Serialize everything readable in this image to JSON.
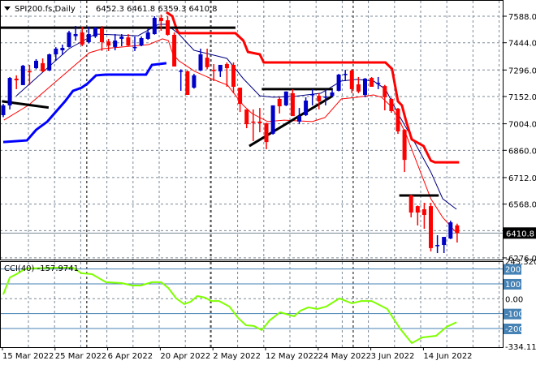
{
  "header": {
    "menu_icon": "triangle-down-icon",
    "symbol_timeframe": "SPI200.fs,Daily",
    "ohlc": "6452.3 6461.8 6359.3 6410.8"
  },
  "cci_panel": {
    "label": "CCI(40) -157.9741",
    "axis_labels": [
      {
        "text": "243.3203",
        "value": 252,
        "boxed": false
      },
      {
        "text": "200",
        "value": 200,
        "boxed": true
      },
      {
        "text": "100",
        "value": 100,
        "boxed": true
      },
      {
        "text": "0.00",
        "value": 0,
        "boxed": false
      },
      {
        "text": "-100",
        "value": -100,
        "boxed": true
      },
      {
        "text": "-200",
        "value": -200,
        "boxed": true
      },
      {
        "text": "-334.110",
        "value": -320,
        "boxed": false
      }
    ],
    "levels": [
      200,
      100,
      -100,
      -200
    ]
  },
  "colors": {
    "bull": "#0000c8",
    "bear": "#ff0000",
    "ma_upper": "#000080",
    "ma_lower": "#ff0000",
    "stop_lower": "#0000ff",
    "stop_upper": "#ff0000",
    "cci": "#7fff00",
    "level": "#4682b4",
    "grid": "#7a8896",
    "trendline": "#000000"
  },
  "chart_data": {
    "type": "candlestick",
    "title": "SPI200.fs,Daily",
    "ylim": [
      6276,
      7650
    ],
    "price_ticks": [
      "7588.0",
      "7444.0",
      "7296.0",
      "7152.0",
      "7004.0",
      "6860.0",
      "6712.0",
      "6568.0",
      "6276.0"
    ],
    "current_price": "6410.8",
    "x_labels": [
      {
        "text": "15 Mar 2022",
        "index": 0
      },
      {
        "text": "25 Mar 2022",
        "index": 8
      },
      {
        "text": "6 Apr 2022",
        "index": 16
      },
      {
        "text": "20 Apr 2022",
        "index": 24
      },
      {
        "text": "2 May 2022",
        "index": 32
      },
      {
        "text": "12 May 2022",
        "index": 40
      },
      {
        "text": "24 May 2022",
        "index": 48
      },
      {
        "text": "3 Jun 2022",
        "index": 56
      },
      {
        "text": "14 Jun 2022",
        "index": 64
      }
    ],
    "period_separators": [
      12.7,
      31.5,
      53.2
    ],
    "candles_ohlc": [
      [
        7051,
        7112,
        7040,
        7104
      ],
      [
        7104,
        7258,
        7082,
        7253
      ],
      [
        7249,
        7267,
        7192,
        7240
      ],
      [
        7214,
        7324,
        7214,
        7319
      ],
      [
        7290,
        7324,
        7214,
        7289
      ],
      [
        7306,
        7355,
        7300,
        7346
      ],
      [
        7333,
        7359,
        7285,
        7289
      ],
      [
        7293,
        7385,
        7290,
        7381
      ],
      [
        7381,
        7420,
        7346,
        7412
      ],
      [
        7403,
        7434,
        7377,
        7416
      ],
      [
        7421,
        7509,
        7418,
        7500
      ],
      [
        7480,
        7535,
        7456,
        7491
      ],
      [
        7500,
        7531,
        7425,
        7434
      ],
      [
        7447,
        7531,
        7440,
        7491
      ],
      [
        7478,
        7531,
        7470,
        7526
      ],
      [
        7522,
        7535,
        7400,
        7447
      ],
      [
        7451,
        7465,
        7399,
        7429
      ],
      [
        7421,
        7491,
        7403,
        7456
      ],
      [
        7465,
        7491,
        7425,
        7478
      ],
      [
        7473,
        7491,
        7425,
        7429
      ],
      [
        7418,
        7478,
        7399,
        7421
      ],
      [
        7429,
        7478,
        7425,
        7469
      ],
      [
        7465,
        7522,
        7460,
        7500
      ],
      [
        7491,
        7588,
        7488,
        7579
      ],
      [
        7579,
        7597,
        7509,
        7562
      ],
      [
        7566,
        7588,
        7482,
        7487
      ],
      [
        7487,
        7500,
        7315,
        7315
      ],
      [
        7289,
        7300,
        7183,
        7293
      ],
      [
        7289,
        7293,
        7161,
        7161
      ],
      [
        7200,
        7275,
        7195,
        7267
      ],
      [
        7293,
        7412,
        7290,
        7381
      ],
      [
        7363,
        7412,
        7300,
        7311
      ],
      [
        7297,
        7328,
        7236,
        7293
      ],
      [
        7289,
        7310,
        7258,
        7324
      ],
      [
        7328,
        7337,
        7205,
        7306
      ],
      [
        7324,
        7337,
        7170,
        7205
      ],
      [
        7200,
        7200,
        7068,
        7112
      ],
      [
        7082,
        7082,
        6980,
        7002
      ],
      [
        7016,
        7082,
        6910,
        7012
      ],
      [
        7016,
        7090,
        6958,
        7007
      ],
      [
        7007,
        7010,
        6866,
        6905
      ],
      [
        6950,
        7104,
        6945,
        7104
      ],
      [
        7139,
        7152,
        7060,
        7099
      ],
      [
        7104,
        7180,
        7100,
        7179
      ],
      [
        7170,
        7192,
        7046,
        7046
      ],
      [
        7016,
        7090,
        7002,
        7046
      ],
      [
        7051,
        7148,
        7046,
        7130
      ],
      [
        7161,
        7192,
        7104,
        7165
      ],
      [
        7156,
        7170,
        7082,
        7126
      ],
      [
        7148,
        7192,
        7104,
        7152
      ],
      [
        7156,
        7187,
        7150,
        7174
      ],
      [
        7183,
        7275,
        7180,
        7271
      ],
      [
        7271,
        7297,
        7236,
        7275
      ],
      [
        7293,
        7300,
        7170,
        7192
      ],
      [
        7218,
        7258,
        7170,
        7179
      ],
      [
        7161,
        7253,
        7148,
        7249
      ],
      [
        7253,
        7258,
        7205,
        7205
      ],
      [
        7225,
        7258,
        7192,
        7227
      ],
      [
        7209,
        7215,
        7077,
        7148
      ],
      [
        7139,
        7145,
        7064,
        7073
      ],
      [
        7086,
        7090,
        6949,
        6963
      ],
      [
        6971,
        6975,
        6742,
        6808
      ],
      [
        6615,
        6619,
        6496,
        6522
      ],
      [
        6557,
        6560,
        6452,
        6522
      ],
      [
        6540,
        6575,
        6434,
        6509
      ],
      [
        6557,
        6575,
        6311,
        6329
      ],
      [
        6342,
        6399,
        6302,
        6346
      ],
      [
        6346,
        6380,
        6302,
        6390
      ],
      [
        6381,
        6478,
        6378,
        6469
      ],
      [
        6452.3,
        6461.8,
        6359.3,
        6410.8
      ]
    ],
    "series": [
      {
        "name": "ma-upper",
        "width": 1,
        "color_key": "ma_upper",
        "points": [
          [
            2,
            7156
          ],
          [
            10,
            7412
          ],
          [
            14,
            7491
          ],
          [
            20.5,
            7482
          ],
          [
            23.6,
            7544
          ],
          [
            24.8,
            7544
          ],
          [
            26.7,
            7491
          ],
          [
            29,
            7403
          ],
          [
            34,
            7359
          ],
          [
            36.5,
            7249
          ],
          [
            39,
            7156
          ],
          [
            41,
            7148
          ],
          [
            44,
            7152
          ],
          [
            48.3,
            7170
          ],
          [
            51.4,
            7236
          ],
          [
            53.8,
            7245
          ],
          [
            56.3,
            7236
          ],
          [
            58.1,
            7192
          ],
          [
            60,
            7060
          ],
          [
            62.5,
            6905
          ],
          [
            65,
            6742
          ],
          [
            66.8,
            6597
          ],
          [
            68.9,
            6540
          ]
        ]
      },
      {
        "name": "ma-lower",
        "width": 1,
        "color_key": "ma_lower",
        "points": [
          [
            0.1,
            7024
          ],
          [
            3.8,
            7104
          ],
          [
            8.1,
            7236
          ],
          [
            13.1,
            7390
          ],
          [
            15.2,
            7412
          ],
          [
            22.1,
            7434
          ],
          [
            24.2,
            7465
          ],
          [
            25.1,
            7456
          ],
          [
            25.8,
            7381
          ],
          [
            26.7,
            7346
          ],
          [
            29.1,
            7289
          ],
          [
            31.6,
            7249
          ],
          [
            34.1,
            7214
          ],
          [
            36.5,
            7104
          ],
          [
            37.8,
            7060
          ],
          [
            40.2,
            7016
          ],
          [
            42.7,
            7024
          ],
          [
            47,
            7016
          ],
          [
            48.9,
            7038
          ],
          [
            51.4,
            7139
          ],
          [
            53.8,
            7148
          ],
          [
            56.3,
            7161
          ],
          [
            57.5,
            7148
          ],
          [
            58.8,
            7104
          ],
          [
            60,
            7038
          ],
          [
            61.2,
            6949
          ],
          [
            63.1,
            6773
          ],
          [
            65,
            6597
          ],
          [
            66.8,
            6496
          ],
          [
            68.9,
            6412
          ]
        ]
      },
      {
        "name": "stop-lower",
        "width": 3,
        "color_key": "stop_lower",
        "points": [
          [
            0,
            6905
          ],
          [
            3.6,
            6914
          ],
          [
            5,
            6971
          ],
          [
            6.7,
            7016
          ],
          [
            8.1,
            7073
          ],
          [
            9.4,
            7126
          ],
          [
            10.6,
            7183
          ],
          [
            11.9,
            7200
          ],
          [
            12.8,
            7222
          ],
          [
            14.1,
            7267
          ],
          [
            15.6,
            7271
          ],
          [
            21.7,
            7271
          ],
          [
            22.6,
            7324
          ],
          [
            24.8,
            7333
          ]
        ]
      },
      {
        "name": "stop-upper",
        "width": 3,
        "color_key": "stop_upper",
        "points": [
          [
            24.8,
            7610
          ],
          [
            25.7,
            7588
          ],
          [
            26.4,
            7513
          ],
          [
            26.7,
            7496
          ],
          [
            35.3,
            7496
          ],
          [
            36.5,
            7456
          ],
          [
            37.2,
            7394
          ],
          [
            39,
            7381
          ],
          [
            39.6,
            7337
          ],
          [
            58.1,
            7337
          ],
          [
            59.1,
            7302
          ],
          [
            60,
            7126
          ],
          [
            60.6,
            7104
          ],
          [
            61.2,
            7024
          ],
          [
            62.1,
            6919
          ],
          [
            63.9,
            6883
          ],
          [
            65,
            6804
          ],
          [
            65.6,
            6795
          ],
          [
            69.3,
            6795
          ]
        ]
      }
    ],
    "trendlines": [
      [
        [
          -0.5,
          7526
        ],
        [
          35.3,
          7526
        ]
      ],
      [
        [
          -0.2,
          7126
        ],
        [
          6.9,
          7092
        ]
      ],
      [
        [
          39.3,
          7192
        ],
        [
          50.1,
          7192
        ]
      ],
      [
        [
          37.4,
          6883
        ],
        [
          50.1,
          7156
        ]
      ],
      [
        [
          60.2,
          6615
        ],
        [
          66.2,
          6615
        ]
      ]
    ],
    "cci": {
      "name": "CCI(40)",
      "period": 40,
      "last": -157.9741,
      "ylim": [
        -334.11,
        243.3203
      ],
      "points": [
        [
          0,
          29
        ],
        [
          1,
          143
        ],
        [
          2,
          165
        ],
        [
          3,
          192
        ],
        [
          3.6,
          203
        ],
        [
          7.8,
          209
        ],
        [
          10.6,
          209
        ],
        [
          11.9,
          171
        ],
        [
          13.5,
          165
        ],
        [
          15.6,
          111
        ],
        [
          18,
          105
        ],
        [
          19.6,
          89
        ],
        [
          20.9,
          89
        ],
        [
          22.6,
          111
        ],
        [
          24,
          111
        ],
        [
          25.1,
          72
        ],
        [
          26.3,
          2
        ],
        [
          27.5,
          -36
        ],
        [
          28.5,
          -20
        ],
        [
          29.5,
          18
        ],
        [
          30.7,
          7
        ],
        [
          31.6,
          -15
        ],
        [
          32.8,
          -15
        ],
        [
          34.4,
          -53
        ],
        [
          35.7,
          -129
        ],
        [
          36.9,
          -178
        ],
        [
          38.1,
          -183
        ],
        [
          39.3,
          -211
        ],
        [
          40.5,
          -145
        ],
        [
          42.1,
          -91
        ],
        [
          44.2,
          -118
        ],
        [
          45.2,
          -80
        ],
        [
          46.4,
          -58
        ],
        [
          47.7,
          -69
        ],
        [
          49.1,
          -53
        ],
        [
          51.1,
          2
        ],
        [
          53,
          -31
        ],
        [
          54.4,
          -15
        ],
        [
          56,
          -15
        ],
        [
          57.2,
          -42
        ],
        [
          58.4,
          -69
        ],
        [
          59.1,
          -118
        ],
        [
          60.4,
          -205
        ],
        [
          62.1,
          -298
        ],
        [
          63.7,
          -260
        ],
        [
          65.8,
          -249
        ],
        [
          67.4,
          -189
        ],
        [
          68.9,
          -158
        ]
      ]
    }
  }
}
